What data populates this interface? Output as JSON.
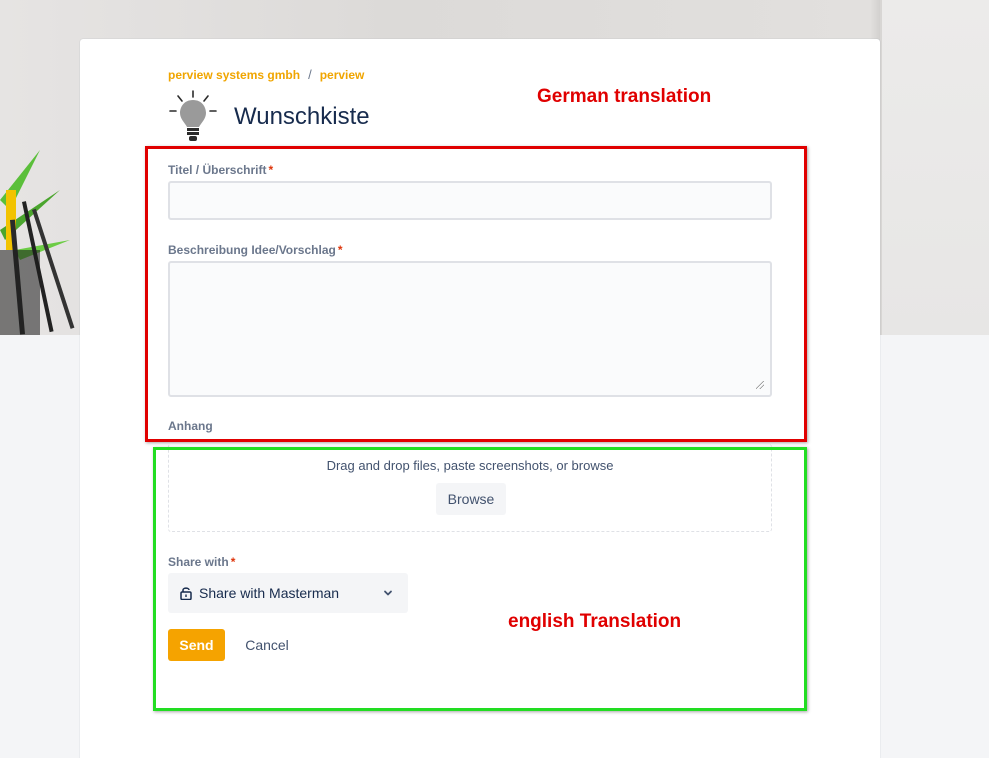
{
  "breadcrumb": {
    "items": [
      "perview systems gmbh",
      "perview"
    ],
    "separator": "/"
  },
  "page": {
    "title": "Wunschkiste",
    "icon": "lightbulb-icon"
  },
  "form": {
    "title_label": "Titel / Überschrift",
    "title_value": "",
    "description_label": "Beschreibung Idee/Vorschlag",
    "description_value": "",
    "attachment_label": "Anhang",
    "required_marker": "*",
    "dropzone_text": "Drag and drop files, paste screenshots, or browse",
    "browse_label": "Browse",
    "share_label": "Share with",
    "share_value": "Share with Masterman",
    "send_label": "Send",
    "cancel_label": "Cancel"
  },
  "annotations": {
    "german": "German translation",
    "english": "english Translation"
  },
  "colors": {
    "accent": "#f5a300",
    "required": "#de350b",
    "annotation_red": "#e00000",
    "annotation_green": "#22dd22"
  }
}
